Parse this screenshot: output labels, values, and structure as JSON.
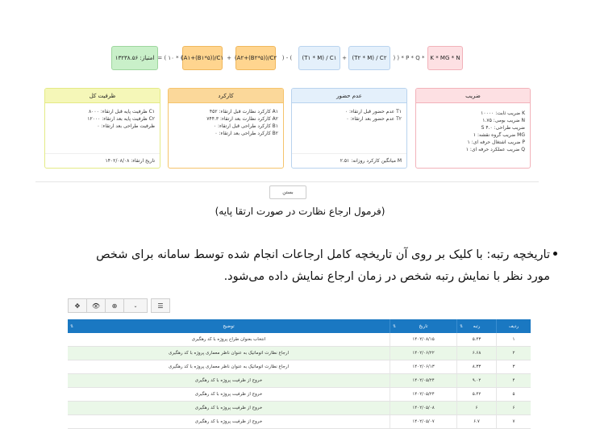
{
  "formula": {
    "result": "امتیاز: ۱۳۲۳۸.۵۶",
    "op_open": "= ( ۱۰ * (",
    "a1": "(A۱+(B۱*۵))/C۱",
    "op_plus1": "+",
    "a2": "(A۲+(B۲*۵))/C۲",
    "op_mid": ") - (",
    "t1": "(T۱ * M) / C۱",
    "op_plus2": "+",
    "t2": "(T۲ * M) / C۲",
    "op_close": ") ) * P * Q *",
    "k": "K * MG * N"
  },
  "cards": {
    "total": {
      "title": "ظرفیت کل",
      "lines": [
        "C۱ ظرفیت پایه قبل ارتقاء: ۸۰۰۰",
        "C۲ ظرفیت پایه بعد ارتقاء: ۱۲۰۰۰",
        "ظرفیت طراحی بعد ارتقاء: ۰"
      ],
      "footer": "تاریخ ارتقاء: ۱۴۰۲/۰۸/۰۸"
    },
    "performance": {
      "title": "کارکرد",
      "lines": [
        "A۱ کارکرد نظارت قبل ارتقاء: ۴۵۲",
        "A۲ کارکرد نظارت بعد ارتقاء: ۷۴۴.۳",
        "B۱ کارکرد طراحی قبل ارتقاء: ۰",
        "B۲ کارکرد طراحی بعد ارتقاء: ۰"
      ]
    },
    "absence": {
      "title": "عدم حضور",
      "lines": [
        "T۱ عدم حضور قبل ارتقاء: ۰",
        "T۲ عدم حضور بعد ارتقاء: ۰"
      ],
      "footer": "M میانگین کارکرد روزانه: ۲.۵۱"
    },
    "coefficient": {
      "title": "ضریب",
      "lines": [
        "K ضریب ثابت: ۱۰۰۰۰",
        "N ضریب بومی: ۱.۷۵",
        "ضریب طراحی: ۴.۰ S",
        "MG ضریب گروه نقشه: ۱",
        "P ضریب اشتغال حرفه ای: ۱",
        "Q ضریب عملکرد حرفه ای: ۱"
      ]
    }
  },
  "close_label": "بستن",
  "caption": "(فرمول ارجاع نظارت در صورت ارتقا پایه)",
  "paragraph": "تاریخچه رتبه: با کلیک بر روی آن تاریخچه کامل ارجاعات انجام شده توسط سامانه برای شخص مورد نظر با نمایش رتبه شخص در زمان ارجاع نمایش داده می‌شود.",
  "toolbar": {
    "move": "✥",
    "view": "👁",
    "zoom": "⊕",
    "dropdown": "⌄",
    "list": "☰"
  },
  "table": {
    "headers": [
      "ردیف",
      "رتبه",
      "تاریخ",
      "توضیح"
    ],
    "sort_glyph": "⇅",
    "rows": [
      [
        "۱",
        "۵.۴۳",
        "۱۴۰۲/۰۸/۱۵",
        "انتخاب بعنوان طراح پروژه با کد رهگیری"
      ],
      [
        "۲",
        "۶.۶۸",
        "۱۴۰۲/۰۶/۲۲",
        "ارجاع نظارت اتوماتیک به عنوان ناظر معماری پروژه با کد رهگیری"
      ],
      [
        "۳",
        "۸.۳۳",
        "۱۴۰۲/۰۶/۱۳",
        "ارجاع نظارت اتوماتیک به عنوان ناظر معماری پروژه با کد رهگیری"
      ],
      [
        "۴",
        "۹.۰۲",
        "۱۴۰۲/۰۵/۲۴",
        "خروج از ظرفیت پروژه با کد رهگیری"
      ],
      [
        "۵",
        "۵.۴۲",
        "۱۴۰۲/۰۵/۲۴",
        "خروج از ظرفیت پروژه با کد رهگیری"
      ],
      [
        "۶",
        "۶",
        "۱۴۰۲/۰۵/۰۸",
        "خروج از ظرفیت پروژه با کد رهگیری"
      ],
      [
        "۷",
        "۶.۷",
        "۱۴۰۲/۰۵/۰۷",
        "خروج از ظرفیت پروژه با کد رهگیری"
      ]
    ]
  }
}
